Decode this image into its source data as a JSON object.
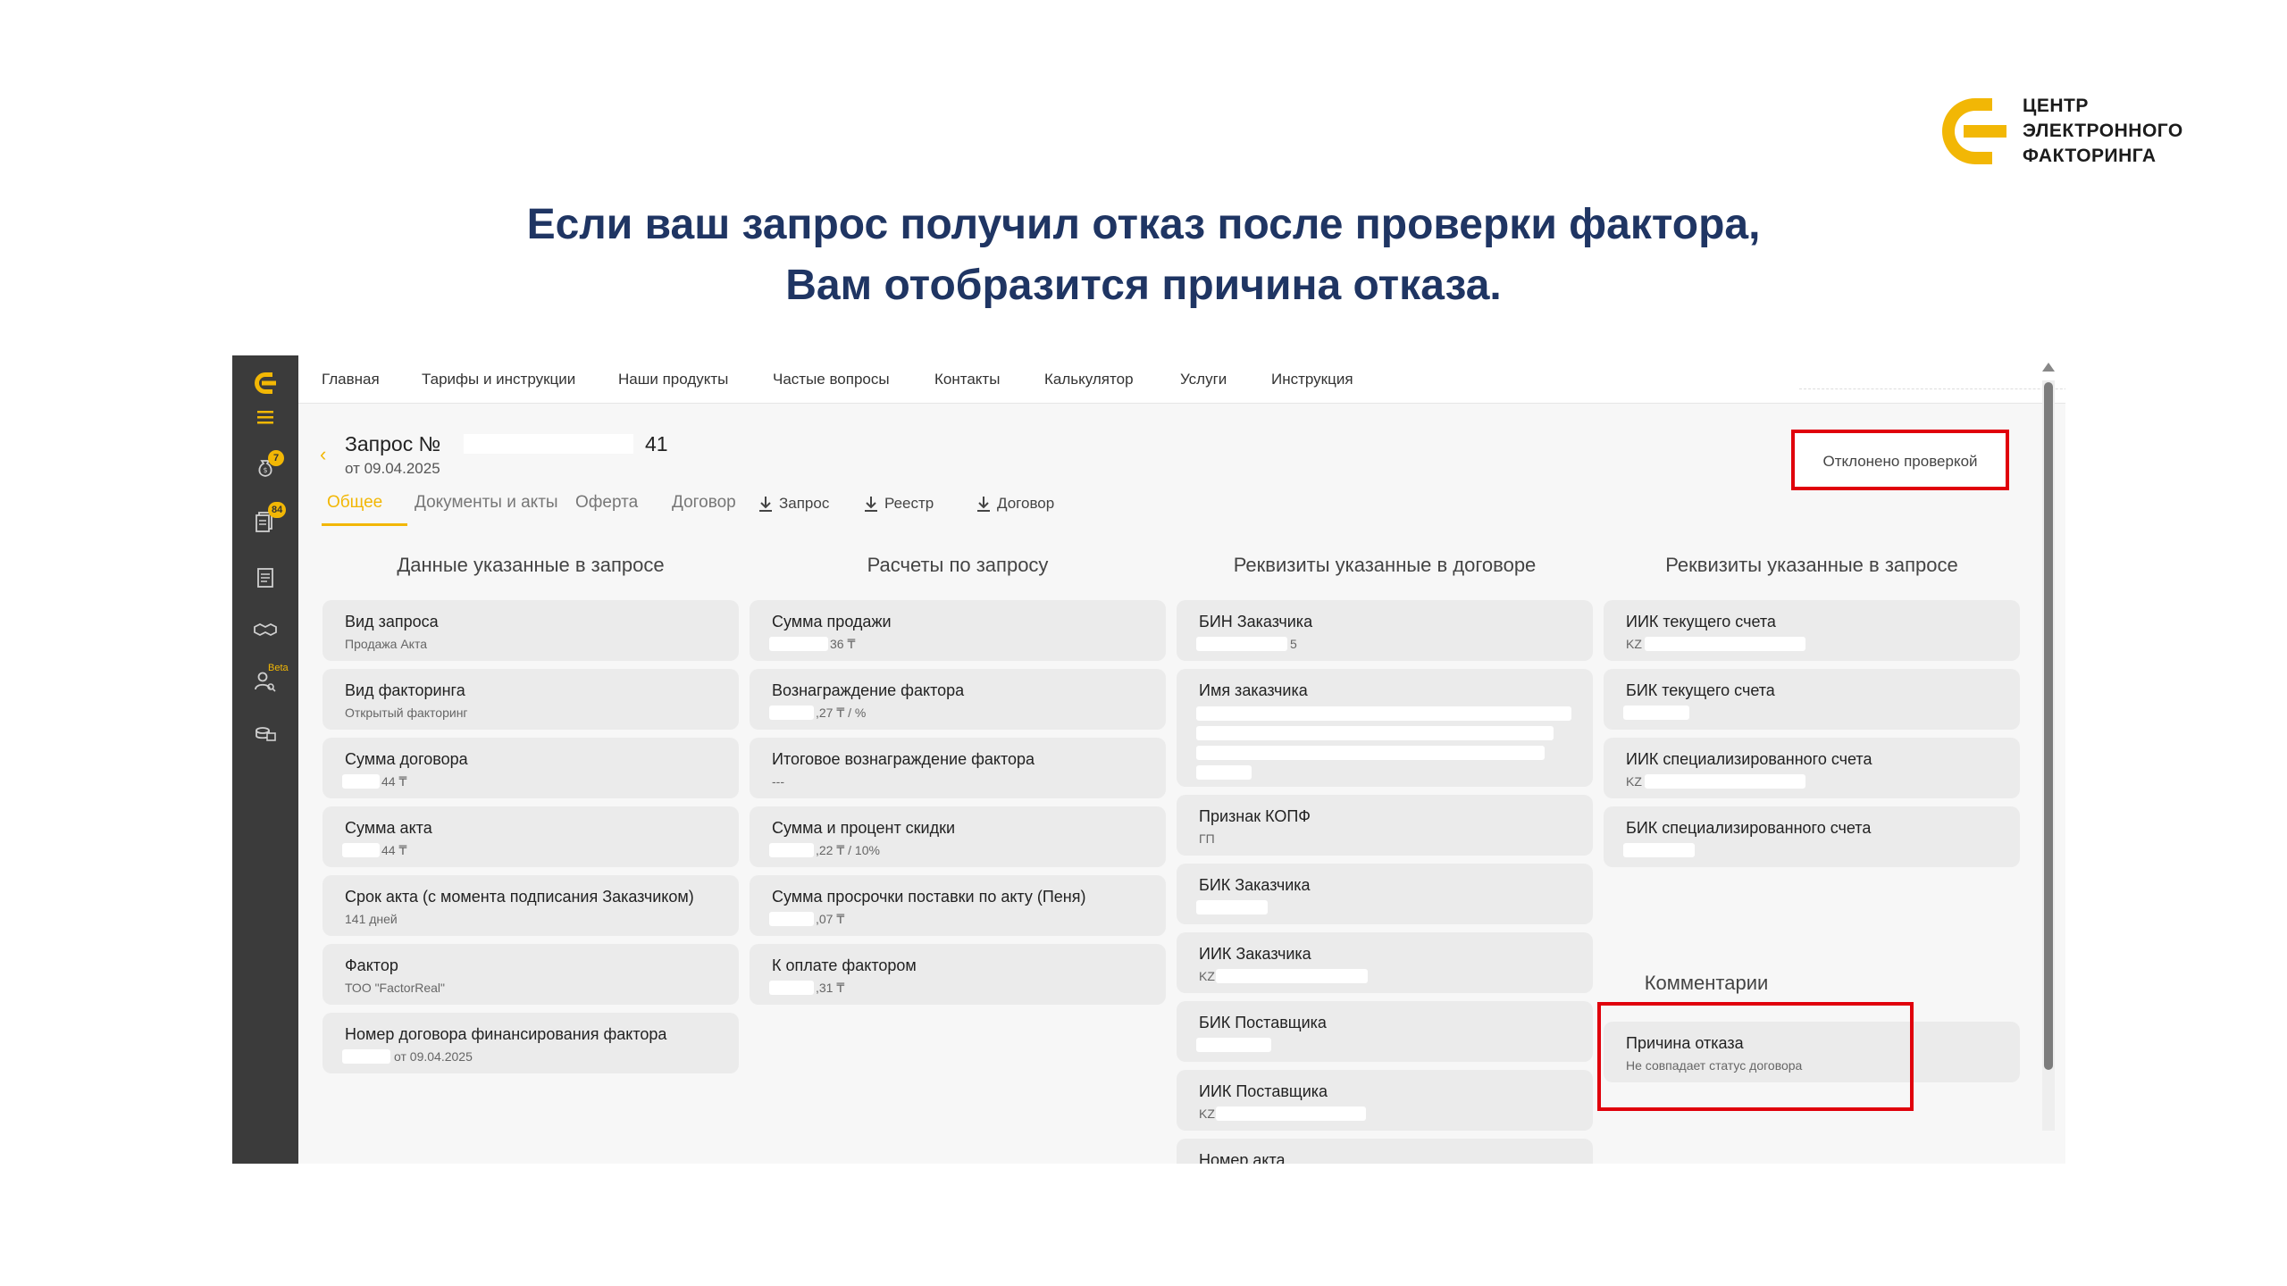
{
  "brand": {
    "line1": "ЦЕНТР",
    "line2": "ЭЛЕКТРОННОГО",
    "line3": "ФАКТОРИНГА",
    "color": "#f2b705"
  },
  "headline": {
    "line1": "Если ваш запрос получил отказ после проверки фактора,",
    "line2": "Вам отобразится причина отказа."
  },
  "sidebar": {
    "badges": {
      "notifications": "7",
      "requests": "84"
    },
    "beta_label": "Beta",
    "icons": [
      "logo-icon",
      "menu-icon",
      "money-bag-icon",
      "documents-stack-icon",
      "document-icon",
      "handshake-icon",
      "user-search-icon",
      "coins-icon"
    ]
  },
  "nav": {
    "items": [
      "Главная",
      "Тарифы и инструкции",
      "Наши продукты",
      "Частые вопросы",
      "Контакты",
      "Калькулятор",
      "Услуги",
      "Инструкция"
    ]
  },
  "request": {
    "title_prefix": "Запрос №",
    "title_suffix": "41",
    "date": "от 09.04.2025",
    "status": "Отклонено проверкой"
  },
  "tabs": [
    "Общее",
    "Документы и акты",
    "Оферта",
    "Договор"
  ],
  "downloads": [
    "Запрос",
    "Реестр",
    "Договор"
  ],
  "columns": [
    {
      "title": "Данные указанные в запросе",
      "cards": [
        {
          "label": "Вид запроса",
          "value": "Продажа Акта"
        },
        {
          "label": "Вид факторинга",
          "value": "Открытый факторинг"
        },
        {
          "label": "Сумма договора",
          "value": "44 ₸"
        },
        {
          "label": "Сумма акта",
          "value": "44 ₸"
        },
        {
          "label": "Срок акта (с момента подписания Заказчиком)",
          "value": "141 дней"
        },
        {
          "label": "Фактор",
          "value": "ТОО \"FactorReal\""
        },
        {
          "label": "Номер договора финансирования фактора",
          "value": "от 09.04.2025"
        }
      ]
    },
    {
      "title": "Расчеты по запросу",
      "cards": [
        {
          "label": "Сумма продажи",
          "value": "36 ₸"
        },
        {
          "label": "Вознаграждение фактора",
          "value": ",27 ₸ /      %"
        },
        {
          "label": "Итоговое вознаграждение фактора",
          "value": "---"
        },
        {
          "label": "Сумма и процент скидки",
          "value": ",22 ₸ / 10%"
        },
        {
          "label": "Сумма просрочки поставки по акту (Пеня)",
          "value": ",07 ₸"
        },
        {
          "label": "К оплате фактором",
          "value": ",31 ₸"
        }
      ]
    },
    {
      "title": "Реквизиты указанные в договоре",
      "cards": [
        {
          "label": "БИН Заказчика",
          "value": "5"
        },
        {
          "label": "Имя заказчика",
          "value": ""
        },
        {
          "label": "Признак КОПФ",
          "value": "ГП"
        },
        {
          "label": "БИК Заказчика",
          "value": ""
        },
        {
          "label": "ИИК Заказчика",
          "value": "KZ"
        },
        {
          "label": "БИК Поставщика",
          "value": ""
        },
        {
          "label": "ИИК Поставщика",
          "value": "KZ"
        },
        {
          "label": "Номер акта",
          "value": ""
        }
      ]
    },
    {
      "title": "Реквизиты указанные в запросе",
      "cards": [
        {
          "label": "ИИК текущего счета",
          "value": "KZ"
        },
        {
          "label": "БИК текущего счета",
          "value": ""
        },
        {
          "label": "ИИК специализированного счета",
          "value": "KZ"
        },
        {
          "label": "БИК специализированного счета",
          "value": ""
        }
      ]
    }
  ],
  "comments": {
    "title": "Комментарии",
    "reason_label": "Причина отказа",
    "reason_value": "Не совпадает статус договора"
  },
  "colors": {
    "accent": "#f2b705",
    "highlight": "#e0000b",
    "headline": "#1f3563",
    "sidebar": "#3b3b3b"
  }
}
